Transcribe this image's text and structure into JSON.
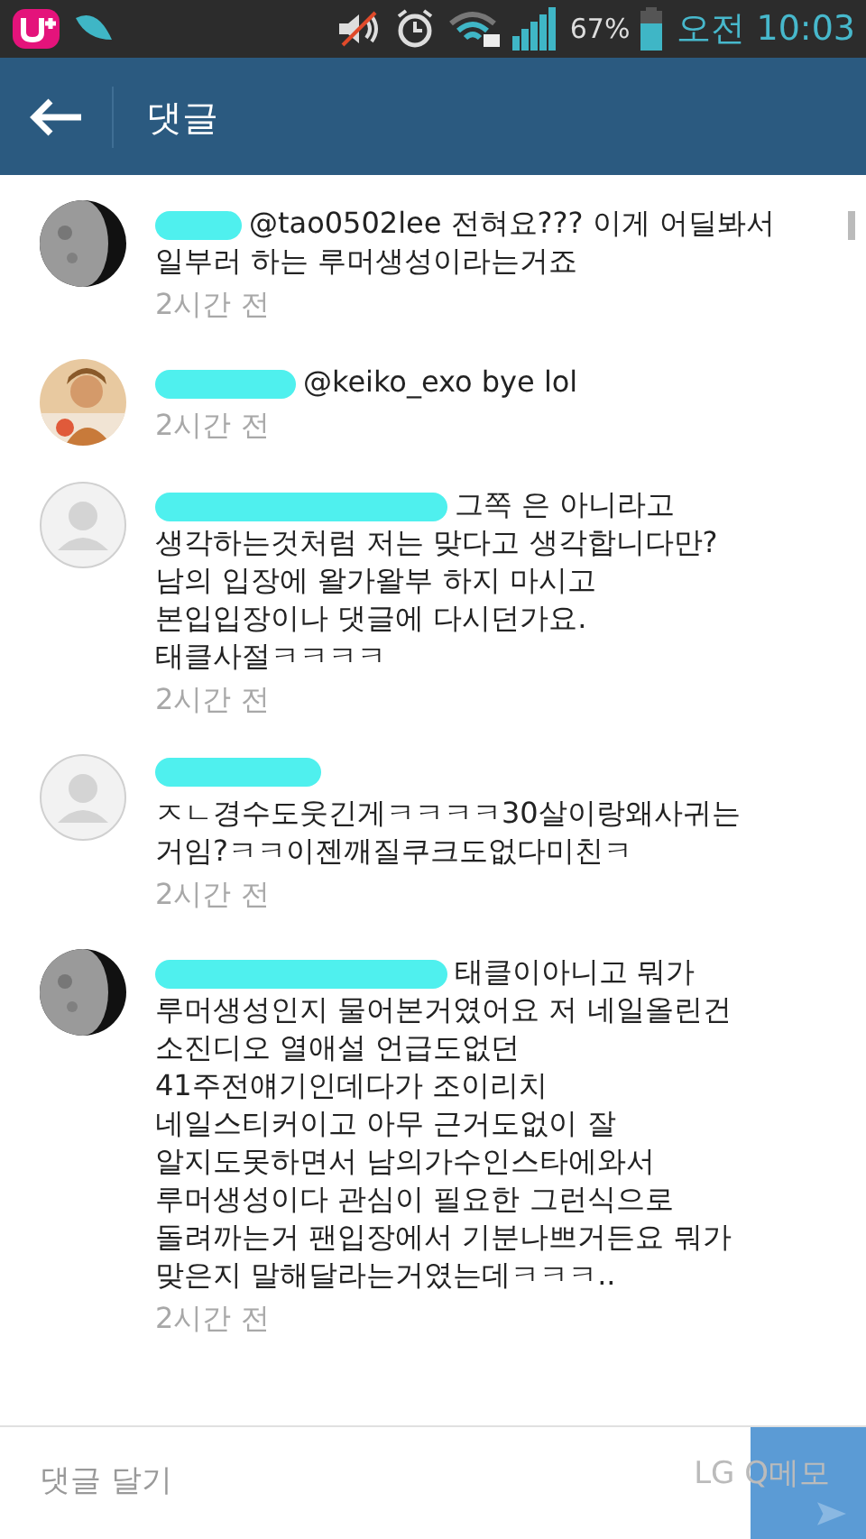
{
  "status_bar": {
    "battery": "67%",
    "time": "오전 10:03",
    "sound_muted": true
  },
  "header": {
    "title": "댓글"
  },
  "comments": [
    {
      "avatar": {
        "kind": "moon"
      },
      "redaction": {
        "kind": "short"
      },
      "text": "@tao0502lee 전혀요??? 이게 어딜봐서\n일부러 하는 루머생성이라는거죠",
      "time": "2시간 전"
    },
    {
      "redaction": {
        "kind": "medium"
      },
      "text": "@keiko_exo bye lol",
      "time": "2시간 전"
    },
    {
      "avatar": {
        "kind": "default"
      },
      "redaction": {
        "kind": "long"
      },
      "text": "그쪽 은 아니라고\n생각하는것처럼 저는 맞다고 생각합니다만?\n남의 입장에 왈가왈부 하지 마시고\n본입입장이나 댓글에 다시던가요.\n태클사절ㅋㅋㅋㅋ",
      "time": "2시간 전"
    },
    {
      "avatar": {
        "kind": "default"
      },
      "redaction": {
        "kind": "line"
      },
      "text": "ㅈㄴ경수도웃긴게ㅋㅋㅋㅋ30살이랑왜사귀는\n거임?ㅋㅋ이젠깨질쿠크도없다미친ㅋ",
      "time": "2시간 전"
    },
    {
      "avatar": {
        "kind": "moon"
      },
      "redaction": {
        "kind": "long"
      },
      "text": "태클이아니고 뭐가\n루머생성인지 물어본거였어요 저 네일올린건\n소진디오 열애설 언급도없던\n41주전얘기인데다가 조이리치\n네일스티커이고 아무 근거도없이 잘\n알지도못하면서 남의가수인스타에와서\n루머생성이다 관심이 필요한 그런식으로\n돌려까는거 팬입장에서 기분나쁘거든요 뭐가\n맞은지 말해달라는거였는데ㅋㅋㅋ..",
      "time": "2시간 전"
    }
  ],
  "composer": {
    "placeholder": "댓글 달기",
    "overlay": "LG Q메모"
  }
}
